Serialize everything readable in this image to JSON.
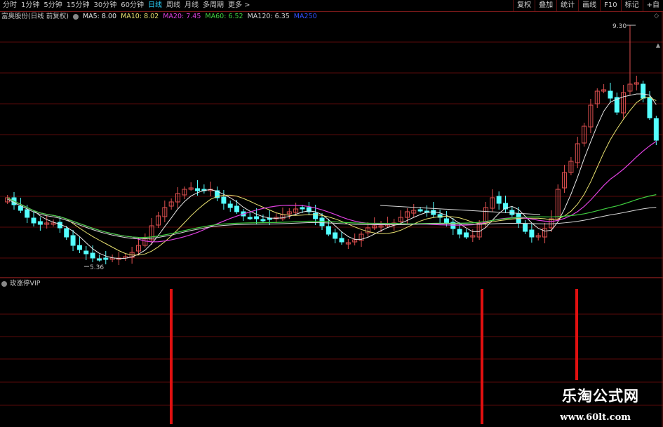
{
  "toolbar": {
    "periods": [
      {
        "label": "分时",
        "active": false
      },
      {
        "label": "1分钟",
        "active": false
      },
      {
        "label": "5分钟",
        "active": false
      },
      {
        "label": "15分钟",
        "active": false
      },
      {
        "label": "30分钟",
        "active": false
      },
      {
        "label": "60分钟",
        "active": false
      },
      {
        "label": "日线",
        "active": true
      },
      {
        "label": "周线",
        "active": false
      },
      {
        "label": "月线",
        "active": false
      },
      {
        "label": "多周期",
        "active": false
      },
      {
        "label": "更多 >",
        "active": false
      }
    ],
    "right_buttons": [
      "复权",
      "叠加",
      "统计",
      "画线",
      "F10",
      "标记",
      "+自"
    ]
  },
  "legend": {
    "title": "富奥股份(日线 前复权)",
    "items": [
      {
        "label": "MA5: 8.00",
        "color": "#e8e8e8"
      },
      {
        "label": "MA10: 8.02",
        "color": "#e8e070"
      },
      {
        "label": "MA20: 7.45",
        "color": "#e040e0"
      },
      {
        "label": "MA60: 6.52",
        "color": "#40d040"
      },
      {
        "label": "MA120: 6.35",
        "color": "#d8d8d8"
      },
      {
        "label": "MA250",
        "color": "#3050ff"
      }
    ]
  },
  "annotations": {
    "max_label": "9.30",
    "min_label": "5.36"
  },
  "indicator": {
    "name": "玫涨停VIP",
    "signal_color": "#e01010"
  },
  "watermark": {
    "line1": "乐淘公式网",
    "line2": "www.60lt.com"
  },
  "colors": {
    "up": "#e05050",
    "down": "#54ffff",
    "grid": "#5a0a0a",
    "border": "#7a1a1a"
  }
}
